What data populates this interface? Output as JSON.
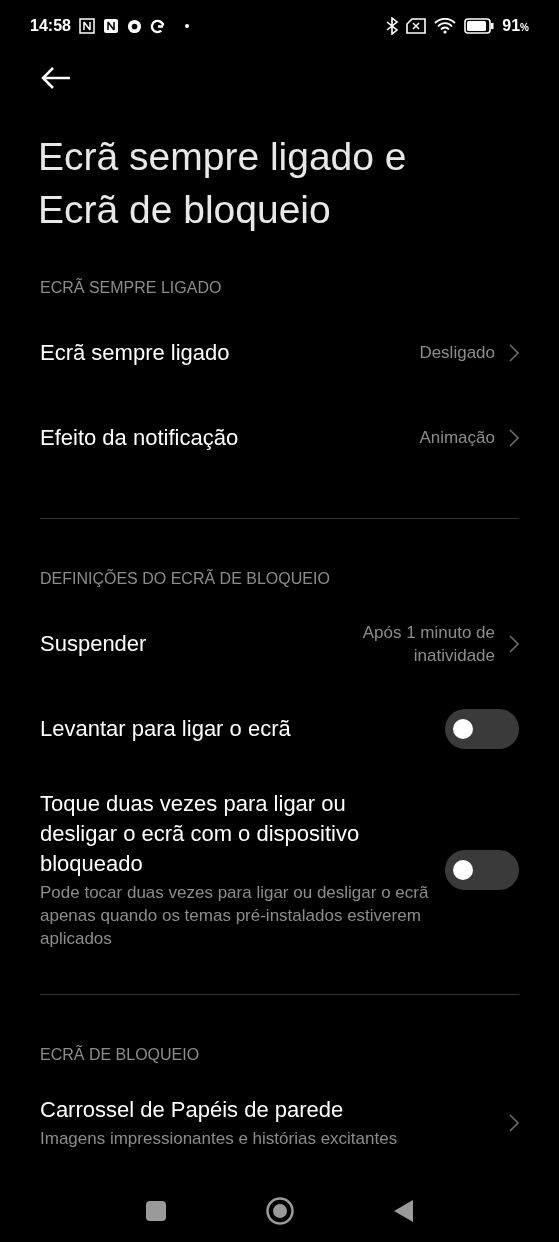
{
  "status_bar": {
    "time": "14:58",
    "battery": "91",
    "battery_unit": "%"
  },
  "title": "Ecrã sempre ligado e Ecrã de bloqueio",
  "sections": [
    {
      "header": "ECRÃ SEMPRE LIGADO",
      "items": [
        {
          "kind": "link",
          "label": "Ecrã sempre ligado",
          "value": "Desligado"
        },
        {
          "kind": "link",
          "label": "Efeito da notificação",
          "value": "Animação"
        }
      ]
    },
    {
      "header": "DEFINIÇÕES DO ECRÃ DE BLOQUEIO",
      "items": [
        {
          "kind": "link",
          "label": "Suspender",
          "value": "Após 1 minuto de inatividade"
        },
        {
          "kind": "toggle",
          "label": "Levantar para ligar o ecrã",
          "on": false
        },
        {
          "kind": "toggle",
          "label": "Toque duas vezes para ligar ou desligar o ecrã com o dispositivo bloqueado",
          "subtitle": "Pode tocar duas vezes para ligar ou desligar o ecrã apenas quando os temas pré-instalados estiverem aplicados",
          "on": false
        }
      ]
    },
    {
      "header": "ECRÃ DE BLOQUEIO",
      "items": [
        {
          "kind": "link",
          "label": "Carrossel de Papéis de parede",
          "subtitle": "Imagens impressionantes e histórias excitantes"
        }
      ]
    }
  ]
}
